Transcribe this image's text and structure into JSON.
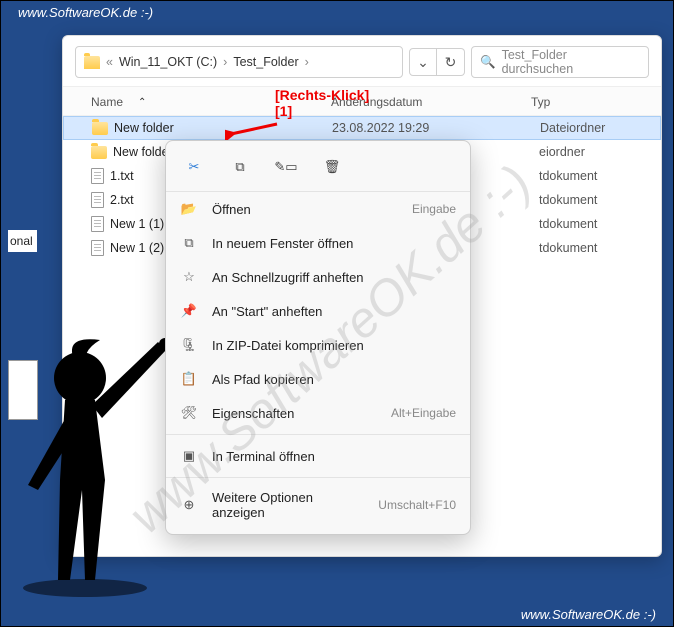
{
  "watermark": "www.SoftwareOK.de  :-)",
  "breadcrumb": {
    "chevrons_prefix": "«",
    "drive": "Win_11_OKT (C:)",
    "folder": "Test_Folder",
    "sep": "›"
  },
  "search": {
    "placeholder": "Test_Folder durchsuchen"
  },
  "columns": {
    "name": "Name",
    "date": "Änderungsdatum",
    "type": "Typ"
  },
  "rows": [
    {
      "icon": "folder",
      "name": "New folder",
      "date": "23.08.2022 19:29",
      "type": "Dateiordner",
      "selected": true
    },
    {
      "icon": "folder",
      "name": "New folder",
      "date": "",
      "type": "eiordner"
    },
    {
      "icon": "file",
      "name": "1.txt",
      "date": "",
      "type": "tdokument"
    },
    {
      "icon": "file",
      "name": "2.txt",
      "date": "",
      "type": "tdokument"
    },
    {
      "icon": "file",
      "name": "New 1 (1).tx",
      "date": "",
      "type": "tdokument"
    },
    {
      "icon": "file",
      "name": "New 1 (2).tx",
      "date": "",
      "type": "tdokument"
    }
  ],
  "sidebar_fragment": "onal",
  "context_menu": {
    "top_icons": [
      "cut",
      "copy",
      "rename",
      "delete"
    ],
    "items": [
      {
        "icon": "📂",
        "label": "Öffnen",
        "shortcut": "Eingabe"
      },
      {
        "icon": "⧉",
        "label": "In neuem Fenster öffnen"
      },
      {
        "icon": "☆",
        "label": "An Schnellzugriff anheften"
      },
      {
        "icon": "📌",
        "label": "An \"Start\" anheften"
      },
      {
        "icon": "🗜",
        "label": "In ZIP-Datei komprimieren"
      },
      {
        "icon": "📋",
        "label": "Als Pfad kopieren"
      },
      {
        "icon": "🛠",
        "label": "Eigenschaften",
        "shortcut": "Alt+Eingabe"
      },
      {
        "icon": "▣",
        "label": "In  Terminal öffnen"
      },
      {
        "icon": "⊕",
        "label": "Weitere Optionen anzeigen",
        "shortcut": "Umschalt+F10"
      }
    ]
  },
  "annotation": {
    "label": "[Rechts-Klick]",
    "num": "[1]"
  }
}
